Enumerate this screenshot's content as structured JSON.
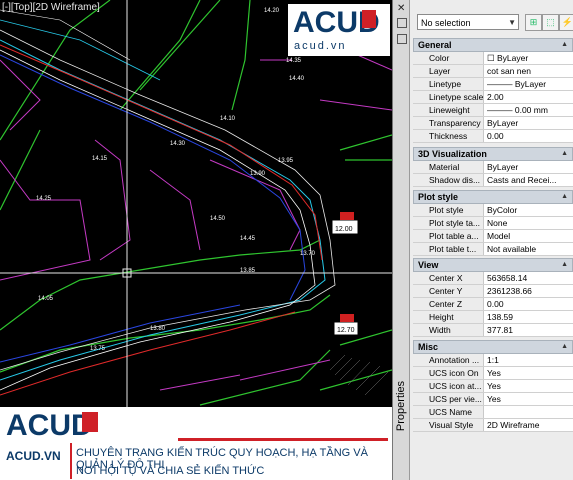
{
  "viewport": {
    "label": "[-][Top][2D Wireframe]",
    "elevations": [
      "14.20",
      "14.35",
      "14.40",
      "14.30",
      "14.15",
      "14.25",
      "14.45",
      "14.50",
      "14.05",
      "13.95",
      "13.90",
      "13.85",
      "13.80",
      "13.75",
      "14.10",
      "13.70"
    ],
    "tags": [
      "12.00",
      "12.70"
    ]
  },
  "logo_top": {
    "brand": "ACUD",
    "sub": "acud.vn"
  },
  "banner": {
    "brand": "ACUD",
    "site": "ACUD.VN",
    "line1": "CHUYÊN TRANG KIẾN TRÚC QUY HOẠCH, HẠ TẦNG VÀ QUẢN LÝ ĐÔ THỊ",
    "line2": "NƠI HỘI TỤ VÀ CHIA SẺ KIẾN THỨC"
  },
  "palette": {
    "title": "Properties",
    "close": "✕",
    "selection": "No selection"
  },
  "sections": [
    {
      "title": "General",
      "rows": [
        {
          "k": "Color",
          "v": "☐ ByLayer"
        },
        {
          "k": "Layer",
          "v": "cot san nen"
        },
        {
          "k": "Linetype",
          "v": "——— ByLayer"
        },
        {
          "k": "Linetype scale",
          "v": "2.00"
        },
        {
          "k": "Lineweight",
          "v": "——— 0.00 mm"
        },
        {
          "k": "Transparency",
          "v": "ByLayer"
        },
        {
          "k": "Thickness",
          "v": "0.00"
        }
      ]
    },
    {
      "title": "3D Visualization",
      "rows": [
        {
          "k": "Material",
          "v": "ByLayer"
        },
        {
          "k": "Shadow dis...",
          "v": "Casts and Recei..."
        }
      ]
    },
    {
      "title": "Plot style",
      "rows": [
        {
          "k": "Plot style",
          "v": "ByColor"
        },
        {
          "k": "Plot style ta...",
          "v": "None"
        },
        {
          "k": "Plot table a...",
          "v": "Model"
        },
        {
          "k": "Plot table t...",
          "v": "Not available"
        }
      ]
    },
    {
      "title": "View",
      "rows": [
        {
          "k": "Center X",
          "v": "563658.14"
        },
        {
          "k": "Center Y",
          "v": "2361238.66"
        },
        {
          "k": "Center Z",
          "v": "0.00"
        },
        {
          "k": "Height",
          "v": "138.59"
        },
        {
          "k": "Width",
          "v": "377.81"
        }
      ]
    },
    {
      "title": "Misc",
      "rows": [
        {
          "k": "Annotation ...",
          "v": "1:1"
        },
        {
          "k": "UCS icon On",
          "v": "Yes"
        },
        {
          "k": "UCS icon at...",
          "v": "Yes"
        },
        {
          "k": "UCS per vie...",
          "v": "Yes"
        },
        {
          "k": "UCS Name",
          "v": ""
        },
        {
          "k": "Visual Style",
          "v": "2D Wireframe"
        }
      ]
    }
  ]
}
